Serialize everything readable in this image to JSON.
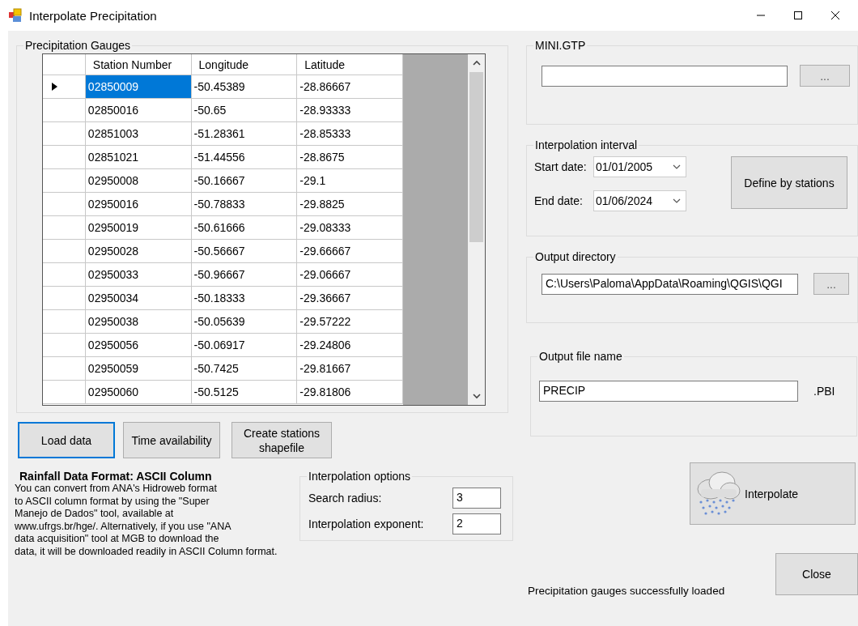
{
  "window": {
    "title": "Interpolate Precipitation"
  },
  "gauges": {
    "title": "Precipitation Gauges",
    "columns": [
      "Station Number",
      "Longitude",
      "Latitude"
    ],
    "rows": [
      {
        "station": "02850009",
        "longitude": "-50.45389",
        "latitude": "-28.86667",
        "selected": true
      },
      {
        "station": "02850016",
        "longitude": "-50.65",
        "latitude": "-28.93333",
        "selected": false
      },
      {
        "station": "02851003",
        "longitude": "-51.28361",
        "latitude": "-28.85333",
        "selected": false
      },
      {
        "station": "02851021",
        "longitude": "-51.44556",
        "latitude": "-28.8675",
        "selected": false
      },
      {
        "station": "02950008",
        "longitude": "-50.16667",
        "latitude": "-29.1",
        "selected": false
      },
      {
        "station": "02950016",
        "longitude": "-50.78833",
        "latitude": "-29.8825",
        "selected": false
      },
      {
        "station": "02950019",
        "longitude": "-50.61666",
        "latitude": "-29.08333",
        "selected": false
      },
      {
        "station": "02950028",
        "longitude": "-50.56667",
        "latitude": "-29.66667",
        "selected": false
      },
      {
        "station": "02950033",
        "longitude": "-50.96667",
        "latitude": "-29.06667",
        "selected": false
      },
      {
        "station": "02950034",
        "longitude": "-50.18333",
        "latitude": "-29.36667",
        "selected": false
      },
      {
        "station": "02950038",
        "longitude": "-50.05639",
        "latitude": "-29.57222",
        "selected": false
      },
      {
        "station": "02950056",
        "longitude": "-50.06917",
        "latitude": "-29.24806",
        "selected": false
      },
      {
        "station": "02950059",
        "longitude": "-50.7425",
        "latitude": "-29.81667",
        "selected": false
      },
      {
        "station": "02950060",
        "longitude": "-50.5125",
        "latitude": "-29.81806",
        "selected": false
      }
    ]
  },
  "buttons": [
    {
      "label": "Load data",
      "focused": true
    },
    {
      "label": "Time availability",
      "focused": false
    },
    {
      "label": "Create stations\nshapefile",
      "focused": false
    }
  ],
  "info": {
    "heading": "Rainfall Data Format: ASCII Column",
    "text": "You can convert from ANA's Hidroweb format\nto ASCII column format by using the \"Super\nManejo de Dados\" tool, available at\nwww.ufrgs.br/hge/. Alternatively, if you use \"ANA\ndata acquisition\" tool at MGB to download the\ndata, it will be downloaded readily in ASCII Column format."
  },
  "interpolation_options": {
    "title": "Interpolation options",
    "fields": [
      {
        "label": "Search radius:",
        "value": "3"
      },
      {
        "label": "Interpolation exponent:",
        "value": "2"
      }
    ]
  },
  "mini_gtp": {
    "title": "MINI.GTP",
    "browse": "..."
  },
  "interval": {
    "title": "Interpolation interval",
    "dates": [
      {
        "label": "Start date:",
        "value": "01/01/2005"
      },
      {
        "label": "End date:",
        "value": "01/06/2024"
      }
    ],
    "button": "Define by stations"
  },
  "output_directory": {
    "title": "Output directory",
    "value": "C:\\Users\\Paloma\\AppData\\Roaming\\QGIS\\QGI",
    "browse": "..."
  },
  "output_file": {
    "title": "Output file name",
    "value": "PRECIP",
    "extension": ".PBI"
  },
  "interpolate_button": "Interpolate",
  "close_button": "Close",
  "status": "Precipitation gauges successfully loaded"
}
